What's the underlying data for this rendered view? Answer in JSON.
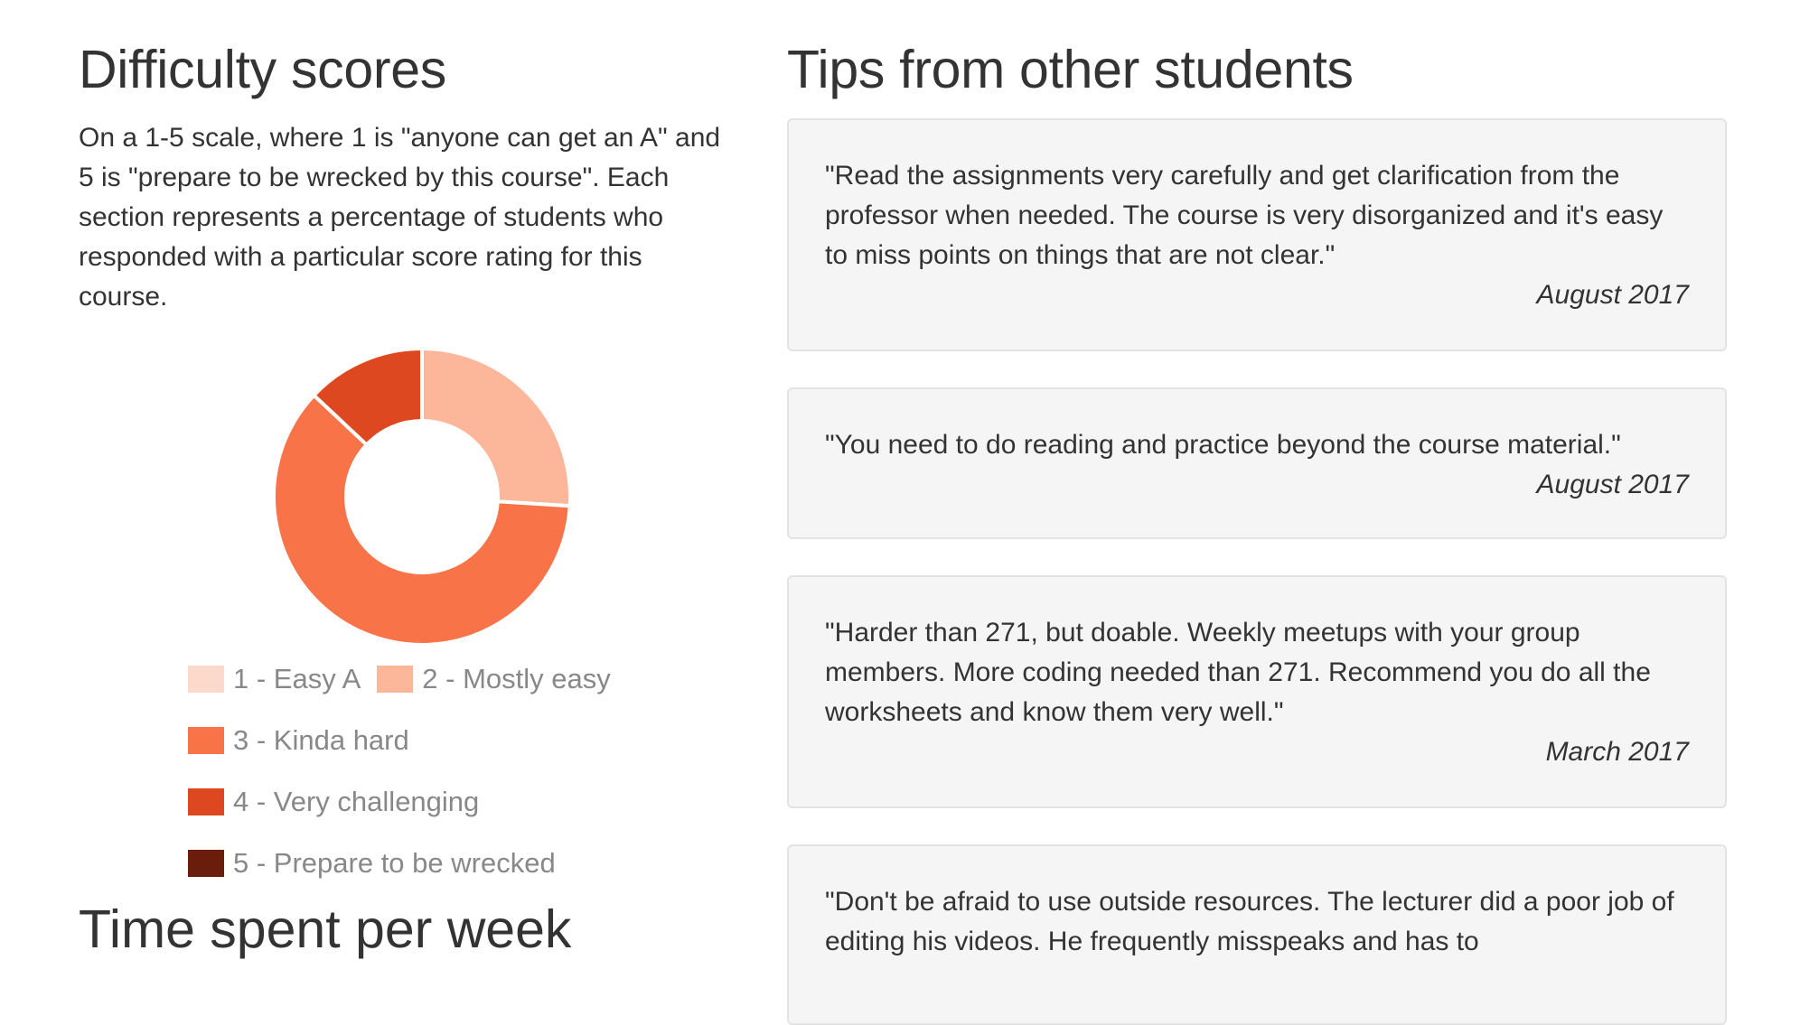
{
  "difficulty": {
    "title": "Difficulty scores",
    "description": "On a 1-5 scale, where 1 is \"anyone can get an A\" and 5 is \"prepare to be wrecked by this course\". Each section represents a percentage of students who responded with a particular score rating for this course.",
    "legend": [
      {
        "label": "1 - Easy A",
        "color": "#fdd9cb"
      },
      {
        "label": "2 - Mostly easy",
        "color": "#fcb69a"
      },
      {
        "label": "3 - Kinda hard",
        "color": "#f87448"
      },
      {
        "label": "4 - Very challenging",
        "color": "#de4820"
      },
      {
        "label": "5 - Prepare to be wrecked",
        "color": "#6b1d0b"
      }
    ]
  },
  "time_section": {
    "title": "Time spent per week"
  },
  "tips": {
    "title": "Tips from other students",
    "items": [
      {
        "text": "\"Read the assignments very carefully and get clarification from the professor when needed. The course is very disorganized and it's easy to miss points on things that are not clear.\"",
        "date": "August 2017"
      },
      {
        "text": "\"You need to do reading and practice beyond the course material.\"",
        "date": "August 2017"
      },
      {
        "text": "\"Harder than 271, but doable. Weekly meetups with your group members. More coding needed than 271. Recommend you do all the worksheets and know them very well.\"",
        "date": "March 2017"
      },
      {
        "text": "\"Don't be afraid to use outside resources. The lecturer did a poor job of editing his videos. He frequently misspeaks and has to",
        "date": ""
      }
    ]
  },
  "chart_data": {
    "type": "pie",
    "donut": true,
    "categories": [
      "1 - Easy A",
      "2 - Mostly easy",
      "3 - Kinda hard",
      "4 - Very challenging",
      "5 - Prepare to be wrecked"
    ],
    "values": [
      0,
      26,
      61,
      13,
      0
    ],
    "colors": [
      "#fdd9cb",
      "#fcb69a",
      "#f87448",
      "#de4820",
      "#6b1d0b"
    ],
    "legend_position": "bottom"
  }
}
